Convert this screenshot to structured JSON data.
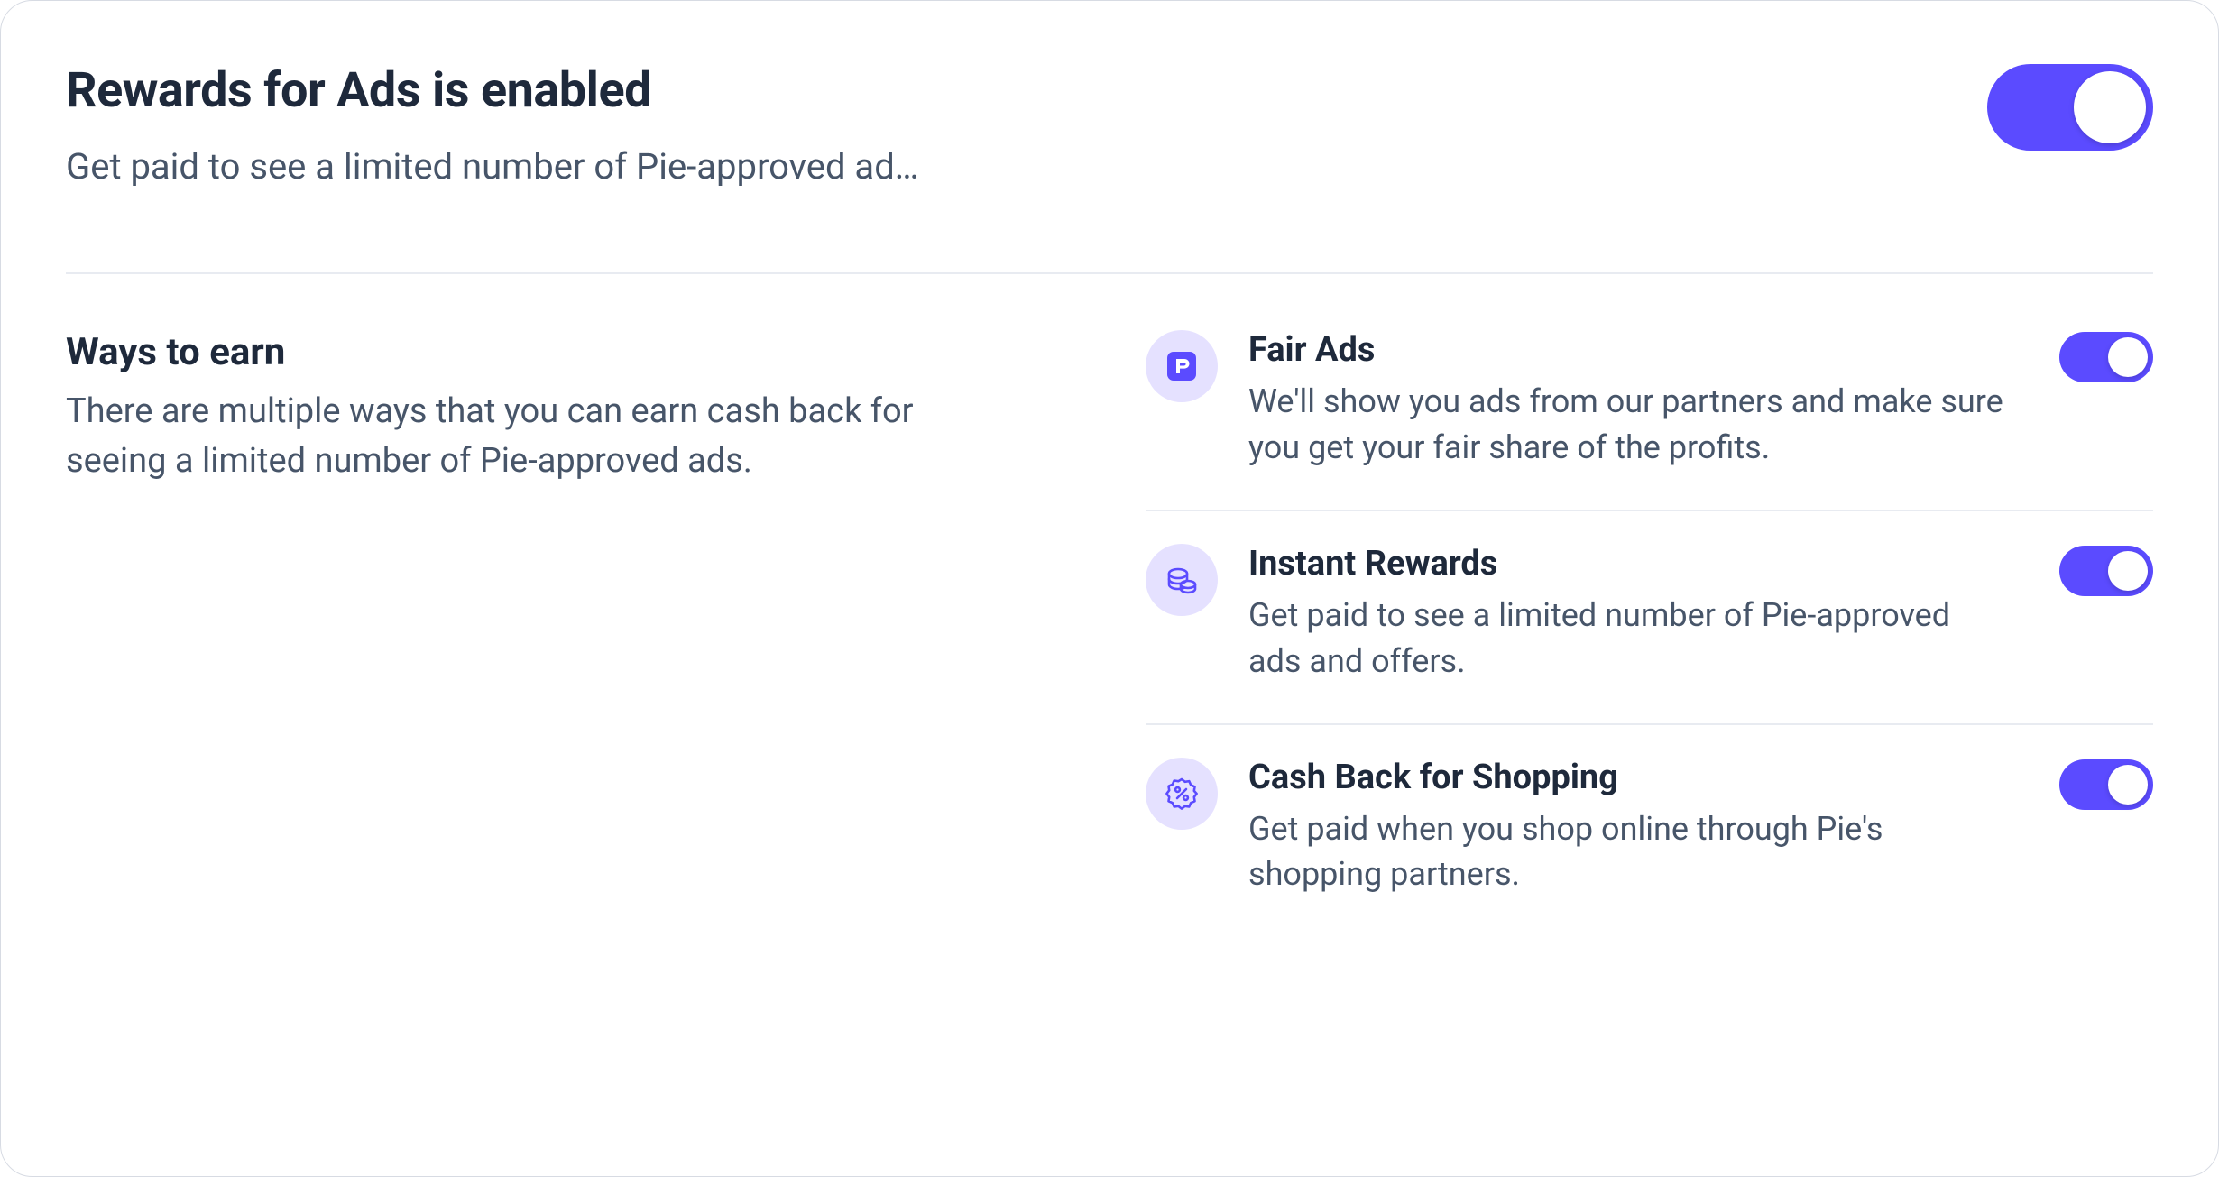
{
  "colors": {
    "accent": "#5b4bff",
    "iconBg": "#e5e1ff",
    "iconFg": "#5b4bff",
    "textPrimary": "#1e293b",
    "textSecondary": "#475569",
    "border": "#e8ebf1"
  },
  "header": {
    "title": "Rewards for Ads is enabled",
    "subtitle": "Get paid to see a limited number of Pie-approved ad…",
    "toggleOn": true
  },
  "ways": {
    "title": "Ways to earn",
    "desc": "There are multiple ways that you can earn cash back for seeing a limited number of Pie-approved ads."
  },
  "options": [
    {
      "icon": "pie-logo-icon",
      "title": "Fair Ads",
      "desc": "We'll show you ads from our partners and make sure you get your fair share of the profits.",
      "on": true
    },
    {
      "icon": "coins-icon",
      "title": "Instant Rewards",
      "desc": "Get paid to see a limited number of Pie-approved ads and offers.",
      "on": true
    },
    {
      "icon": "percent-badge-icon",
      "title": "Cash Back for Shopping",
      "desc": "Get paid when you shop online through Pie's shopping partners.",
      "on": true
    }
  ]
}
